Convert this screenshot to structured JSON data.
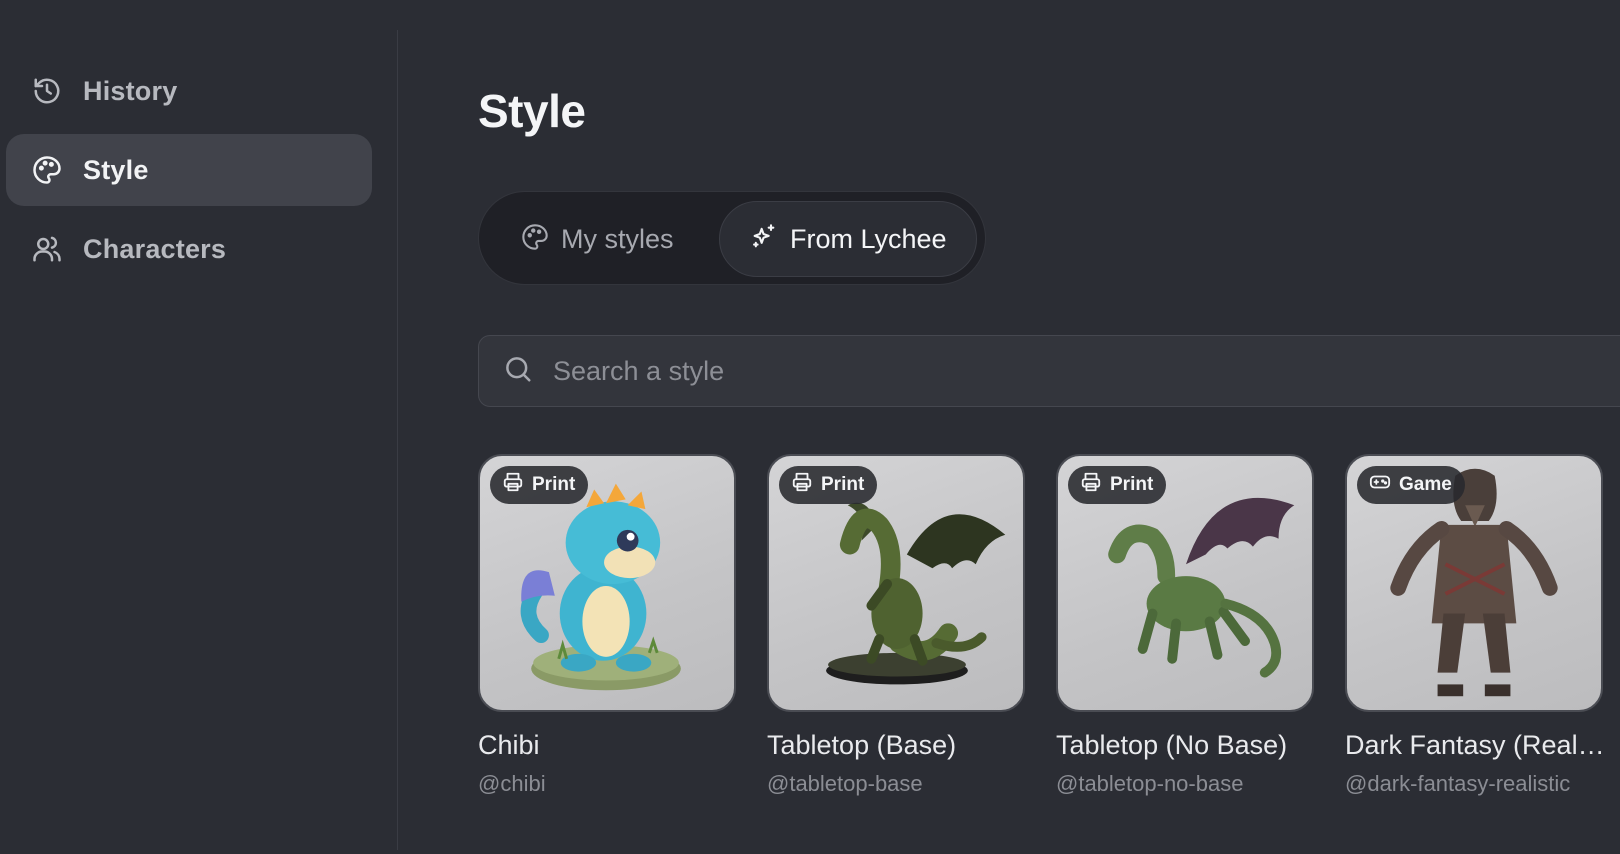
{
  "sidebar": {
    "items": [
      {
        "label": "History",
        "icon": "history-icon",
        "active": false
      },
      {
        "label": "Style",
        "icon": "palette-icon",
        "active": true
      },
      {
        "label": "Characters",
        "icon": "users-icon",
        "active": false
      }
    ]
  },
  "main": {
    "title": "Style",
    "toggle": {
      "options": [
        {
          "label": "My styles",
          "icon": "palette-icon",
          "selected": false
        },
        {
          "label": "From Lychee",
          "icon": "sparkles-icon",
          "selected": true
        }
      ]
    },
    "search": {
      "placeholder": "Search a style",
      "value": ""
    },
    "cards": [
      {
        "badge": "Print",
        "badge_icon": "printer-icon",
        "title": "Chibi",
        "handle": "@chibi"
      },
      {
        "badge": "Print",
        "badge_icon": "printer-icon",
        "title": "Tabletop (Base)",
        "handle": "@tabletop-base"
      },
      {
        "badge": "Print",
        "badge_icon": "printer-icon",
        "title": "Tabletop (No Base)",
        "handle": "@tabletop-no-base"
      },
      {
        "badge": "Game",
        "badge_icon": "gamepad-icon",
        "title": "Dark Fantasy (Realistic)",
        "handle": "@dark-fantasy-realistic"
      }
    ]
  },
  "colors": {
    "background": "#2b2d34",
    "sidebar_active": "#41434b",
    "toggle_track": "#1f2026",
    "text_primary": "#f4f5f7",
    "text_muted": "#8b8d94"
  }
}
